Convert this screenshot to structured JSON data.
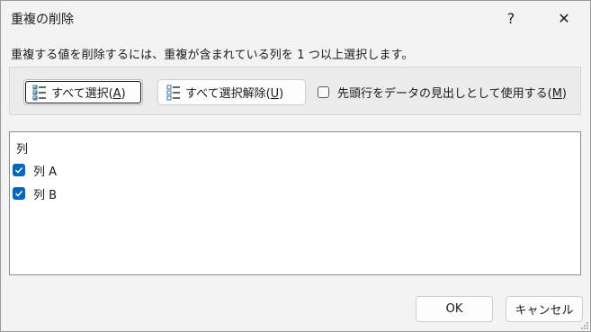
{
  "window": {
    "title": "重複の削除",
    "help_label": "?",
    "close_label": "✕"
  },
  "instruction": "重複する値を削除するには、重複が含まれている列を 1 つ以上選択します。",
  "buttons": {
    "select_all_text": "すべて選択(",
    "select_all_key": "A",
    "select_all_end": ")",
    "unselect_all_text": "すべて選択解除(",
    "unselect_all_key": "U",
    "unselect_all_end": ")",
    "ok": "OK",
    "cancel": "キャンセル"
  },
  "header_option": {
    "text": "先頭行をデータの見出しとして使用する(",
    "key": "M",
    "end": ")",
    "checked": false
  },
  "columns": {
    "header": "列",
    "items": [
      {
        "label": "列 A",
        "checked": true
      },
      {
        "label": "列 B",
        "checked": true
      }
    ]
  },
  "colors": {
    "accent": "#0067c0",
    "dialog_bg": "#f3f3f3"
  }
}
